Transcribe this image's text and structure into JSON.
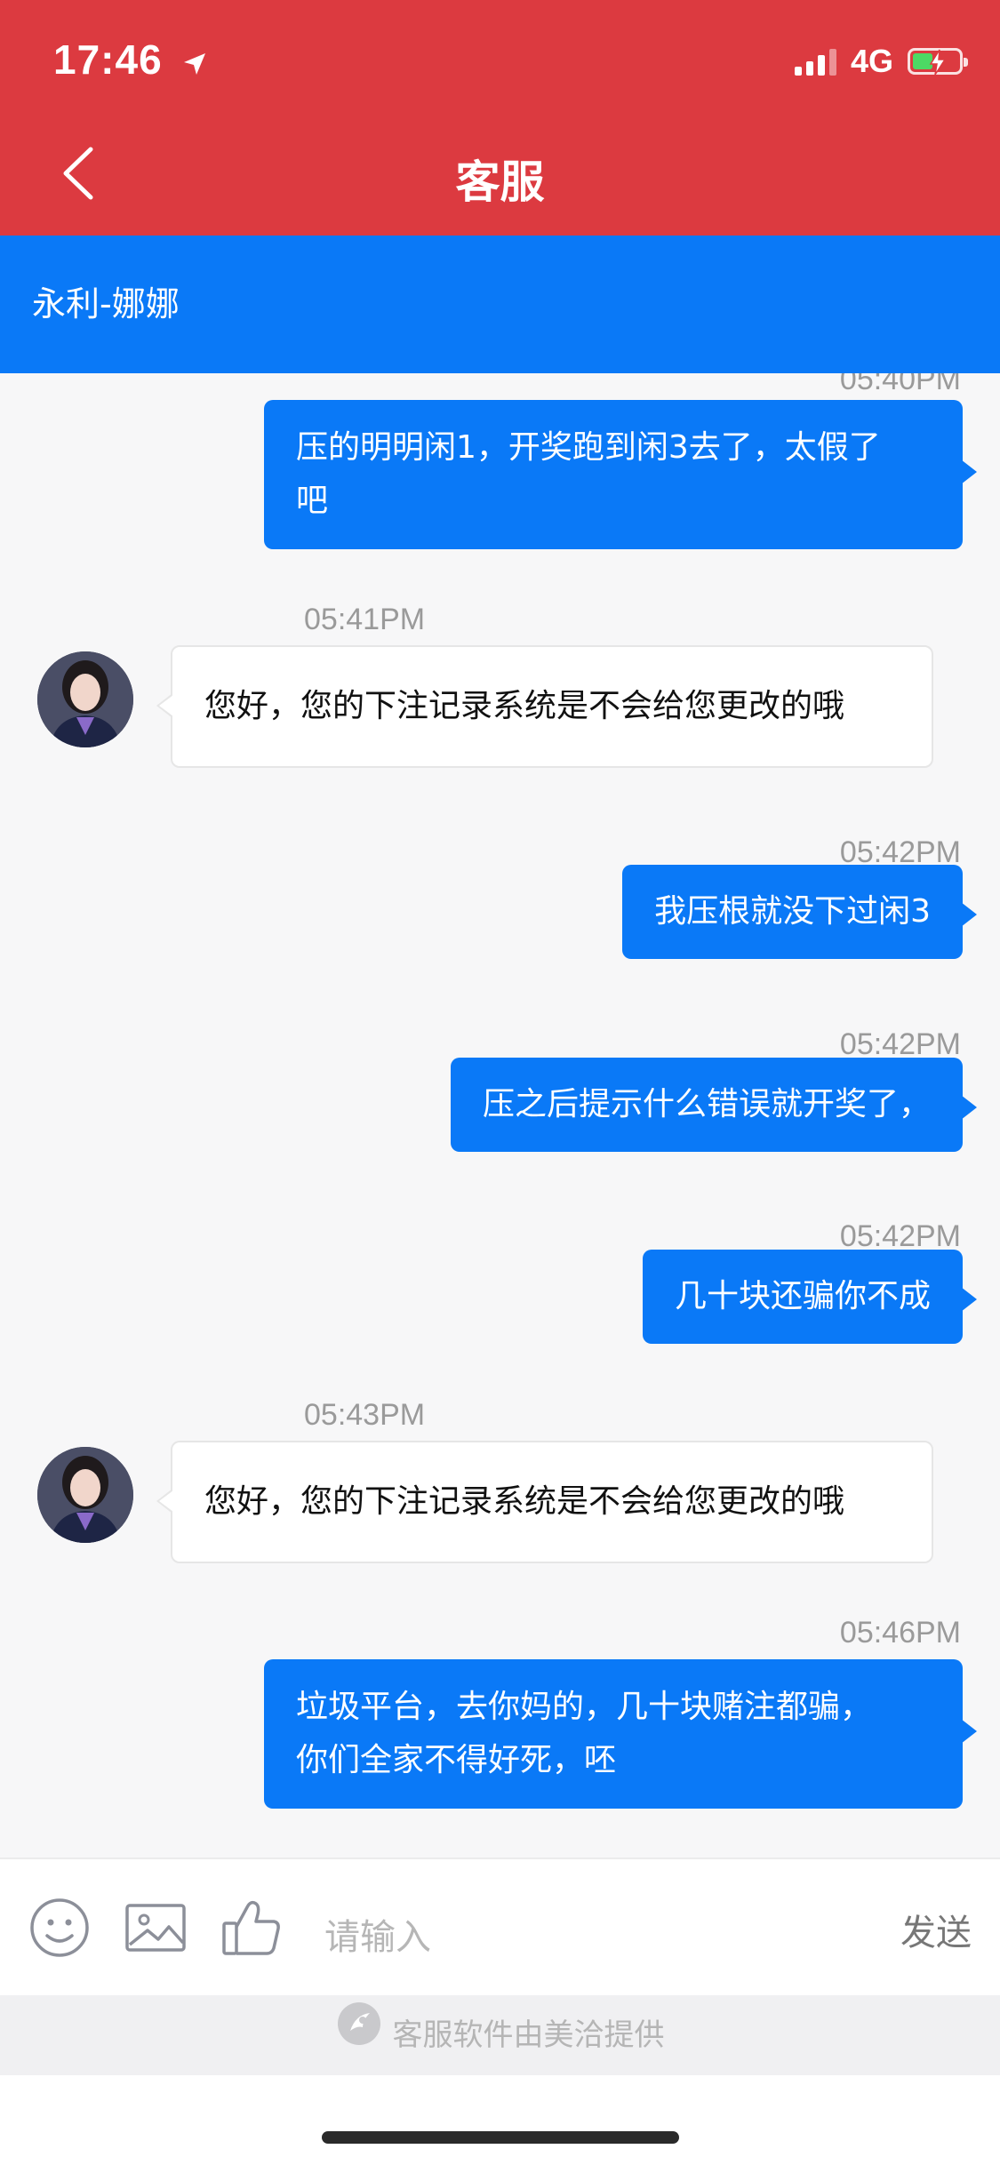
{
  "status_bar": {
    "time": "17:46",
    "network": "4G"
  },
  "header": {
    "title": "客服"
  },
  "agent_bar": {
    "name": "永利-娜娜"
  },
  "messages": [
    {
      "dir": "out",
      "time": "05:40PM",
      "lines": [
        "压的明明闲1，开奖跑到闲3去了，太假了",
        "吧"
      ]
    },
    {
      "dir": "in",
      "time": "05:41PM",
      "lines": [
        "您好，您的下注记录系统是不会给您更改的哦"
      ]
    },
    {
      "dir": "out",
      "time": "05:42PM",
      "lines": [
        "我压根就没下过闲3"
      ]
    },
    {
      "dir": "out",
      "time": "05:42PM",
      "lines": [
        "压之后提示什么错误就开奖了，"
      ]
    },
    {
      "dir": "out",
      "time": "05:42PM",
      "lines": [
        "几十块还骗你不成"
      ]
    },
    {
      "dir": "in",
      "time": "05:43PM",
      "lines": [
        "您好，您的下注记录系统是不会给您更改的哦"
      ]
    },
    {
      "dir": "out",
      "time": "05:46PM",
      "lines": [
        "垃圾平台，去你妈的，几十块赌注都骗，",
        "你们全家不得好死，呸"
      ]
    }
  ],
  "composer": {
    "placeholder": "请输入",
    "send_label": "发送"
  },
  "footer": {
    "text": "客服软件由美洽提供"
  },
  "colors": {
    "header_red": "#dc3a40",
    "accent_blue": "#0a79f7",
    "battery_green": "#4cd964"
  },
  "icons": [
    "location-arrow-icon",
    "signal-icon",
    "battery-icon",
    "back-chevron-icon",
    "emoji-icon",
    "image-icon",
    "thumbs-up-icon",
    "meiqia-logo-icon"
  ]
}
